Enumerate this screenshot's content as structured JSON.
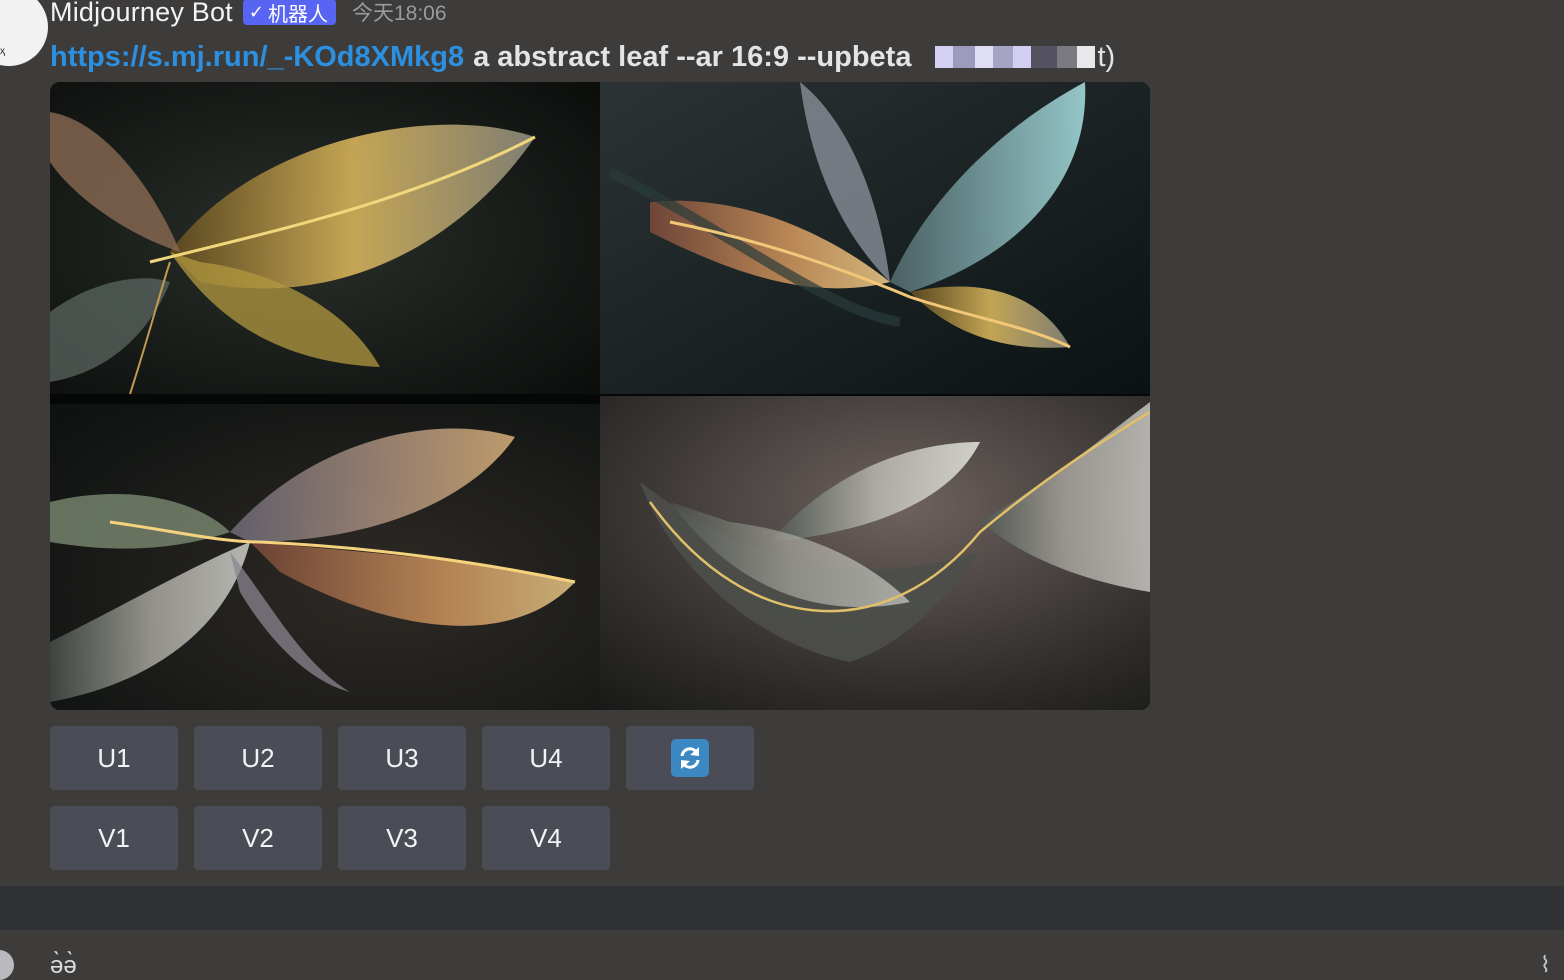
{
  "header": {
    "username": "Midjourney Bot",
    "bot_tag_check": "✓",
    "bot_tag_label": "机器人",
    "timestamp": "今天18:06"
  },
  "message": {
    "link_text": "https://s.mj.run/_-KOd8XMkg8",
    "prompt_text": "a abstract leaf --ar 16:9 --upbeta",
    "suffix": "t)"
  },
  "image_grid": {
    "alt": "four abstract leaf variations"
  },
  "buttons": {
    "upscale": [
      "U1",
      "U2",
      "U3",
      "U4"
    ],
    "variation": [
      "V1",
      "V2",
      "V3",
      "V4"
    ],
    "reroll_icon": "refresh-icon"
  },
  "composer": {
    "text": "ə̀ə̀"
  },
  "colors": {
    "background": "#3d3c3a",
    "link": "#2c8fe0",
    "bot_tag": "#5865f2",
    "button": "#4b4d56",
    "reroll": "#3b88c3"
  }
}
